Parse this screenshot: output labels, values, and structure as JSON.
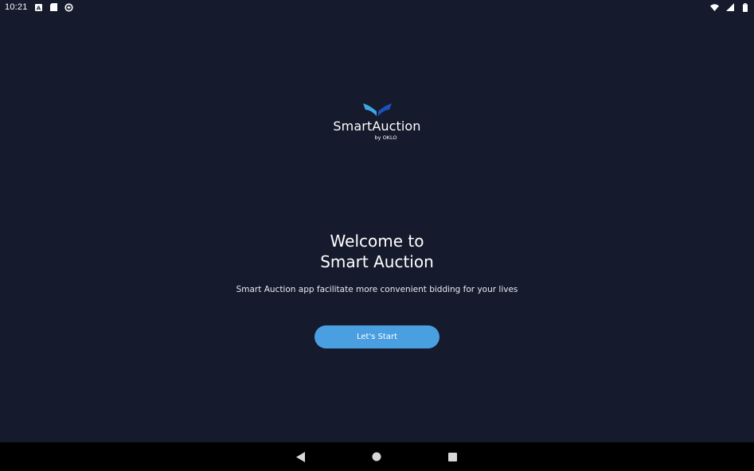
{
  "status_bar": {
    "time": "10:21",
    "left_icons": [
      "a-icon",
      "sd-card-icon",
      "data-saver-icon"
    ],
    "right_icons": [
      "wifi-icon",
      "signal-icon",
      "battery-icon"
    ]
  },
  "logo": {
    "name": "SmartAuction",
    "by": "by OKLO",
    "colors": {
      "left_wing": "#3fa6e6",
      "right_wing": "#1e4fbf"
    }
  },
  "welcome": {
    "title_line1": "Welcome to",
    "title_line2": "Smart Auction",
    "subtitle": "Smart Auction app facilitate more convenient bidding for your lives"
  },
  "start_button": {
    "label": "Let's Start",
    "color": "#4a9fe0"
  },
  "nav_bar": {
    "icons": [
      "back-icon",
      "home-icon",
      "recents-icon"
    ]
  },
  "colors": {
    "background": "#151b2c",
    "nav_background": "#000000"
  }
}
